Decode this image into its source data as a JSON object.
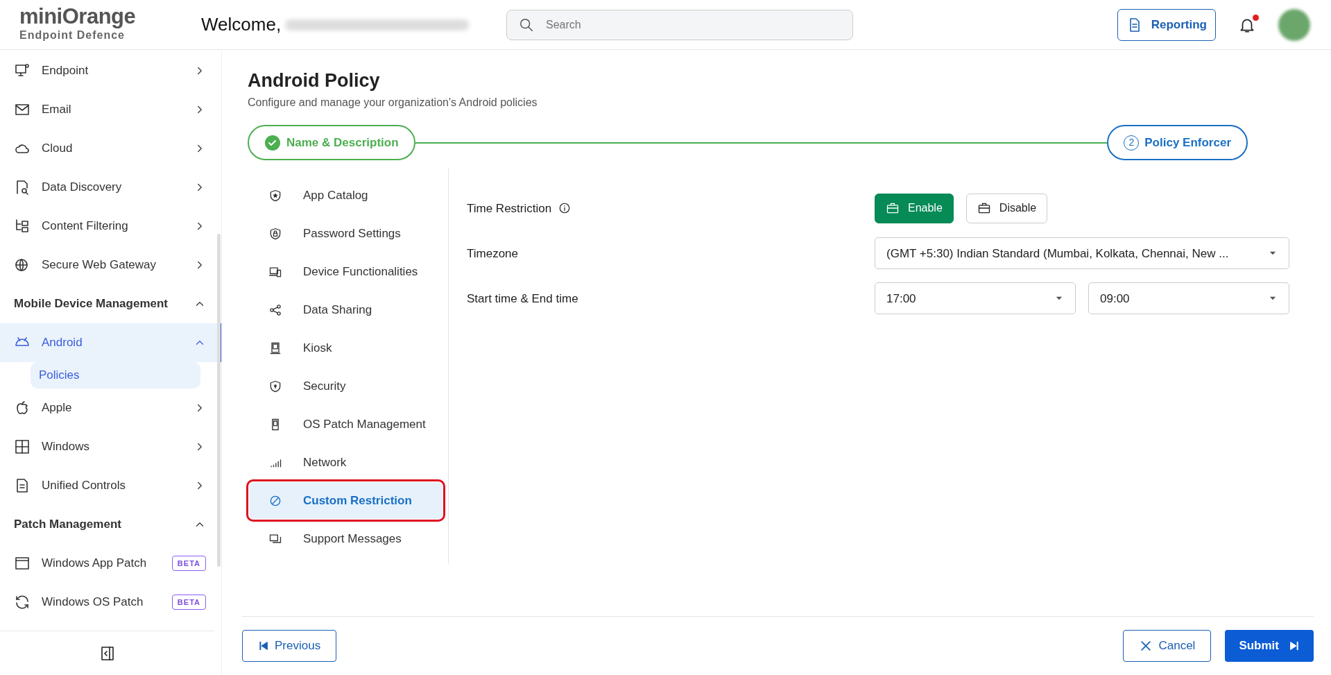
{
  "header": {
    "logo_text": "miniOrange",
    "logo_subtitle": "Endpoint Defence",
    "welcome": "Welcome,",
    "search": {
      "placeholder": "Search"
    },
    "reporting_button": "Reporting",
    "notifications_unread": true
  },
  "sidebar": {
    "items": [
      {
        "kind": "item",
        "label": "Endpoint",
        "expanded": false,
        "selected": false
      },
      {
        "kind": "item",
        "label": "Email",
        "expanded": false,
        "selected": false
      },
      {
        "kind": "item",
        "label": "Cloud",
        "expanded": false,
        "selected": false
      },
      {
        "kind": "item",
        "label": "Data Discovery",
        "expanded": false,
        "selected": false
      },
      {
        "kind": "item",
        "label": "Content Filtering",
        "expanded": false,
        "selected": false
      },
      {
        "kind": "item",
        "label": "Secure Web Gateway",
        "expanded": false,
        "selected": false
      },
      {
        "kind": "section",
        "label": "Mobile Device Management",
        "expanded": true
      },
      {
        "kind": "item",
        "label": "Android",
        "expanded": true,
        "selected": true,
        "children": [
          {
            "label": "Policies",
            "selected": true
          }
        ]
      },
      {
        "kind": "item",
        "label": "Apple",
        "expanded": false,
        "selected": false
      },
      {
        "kind": "item",
        "label": "Windows",
        "expanded": false,
        "selected": false
      },
      {
        "kind": "item",
        "label": "Unified Controls",
        "expanded": false,
        "selected": false
      },
      {
        "kind": "section",
        "label": "Patch Management",
        "expanded": true
      },
      {
        "kind": "item",
        "label": "Windows App Patch",
        "badge": "BETA",
        "selected": false
      },
      {
        "kind": "item",
        "label": "Windows OS Patch",
        "badge": "BETA",
        "selected": false
      }
    ]
  },
  "page": {
    "title": "Android Policy",
    "subtitle": "Configure and manage your organization's Android policies"
  },
  "stepper": [
    {
      "label": "Name & Description",
      "completed": true
    },
    {
      "number": "2",
      "label": "Policy Enforcer",
      "completed": false
    }
  ],
  "policy_menu": [
    {
      "label": "App Catalog",
      "selected": false,
      "highlighted": false
    },
    {
      "label": "Password Settings",
      "selected": false,
      "highlighted": false
    },
    {
      "label": "Device Functionalities",
      "selected": false,
      "highlighted": false
    },
    {
      "label": "Data Sharing",
      "selected": false,
      "highlighted": false
    },
    {
      "label": "Kiosk",
      "selected": false,
      "highlighted": false
    },
    {
      "label": "Security",
      "selected": false,
      "highlighted": false
    },
    {
      "label": "OS Patch Management",
      "selected": false,
      "highlighted": false
    },
    {
      "label": "Network",
      "selected": false,
      "highlighted": false
    },
    {
      "label": "Custom Restriction",
      "selected": true,
      "highlighted": true
    },
    {
      "label": "Support Messages",
      "selected": false,
      "highlighted": false
    }
  ],
  "settings": [
    {
      "kind": "toggle",
      "label": "Time Restriction",
      "info": true,
      "options": [
        {
          "label": "Enable",
          "selected": true
        },
        {
          "label": "Disable",
          "selected": false
        }
      ]
    },
    {
      "kind": "select",
      "label": "Timezone",
      "values": [
        "(GMT +5:30) Indian Standard (Mumbai, Kolkata, Chennai, New ..."
      ]
    },
    {
      "kind": "select",
      "label": "Start time & End time",
      "values": [
        "17:00",
        "09:00"
      ]
    }
  ],
  "footer": {
    "previous": "Previous",
    "cancel": "Cancel",
    "submit": "Submit"
  }
}
